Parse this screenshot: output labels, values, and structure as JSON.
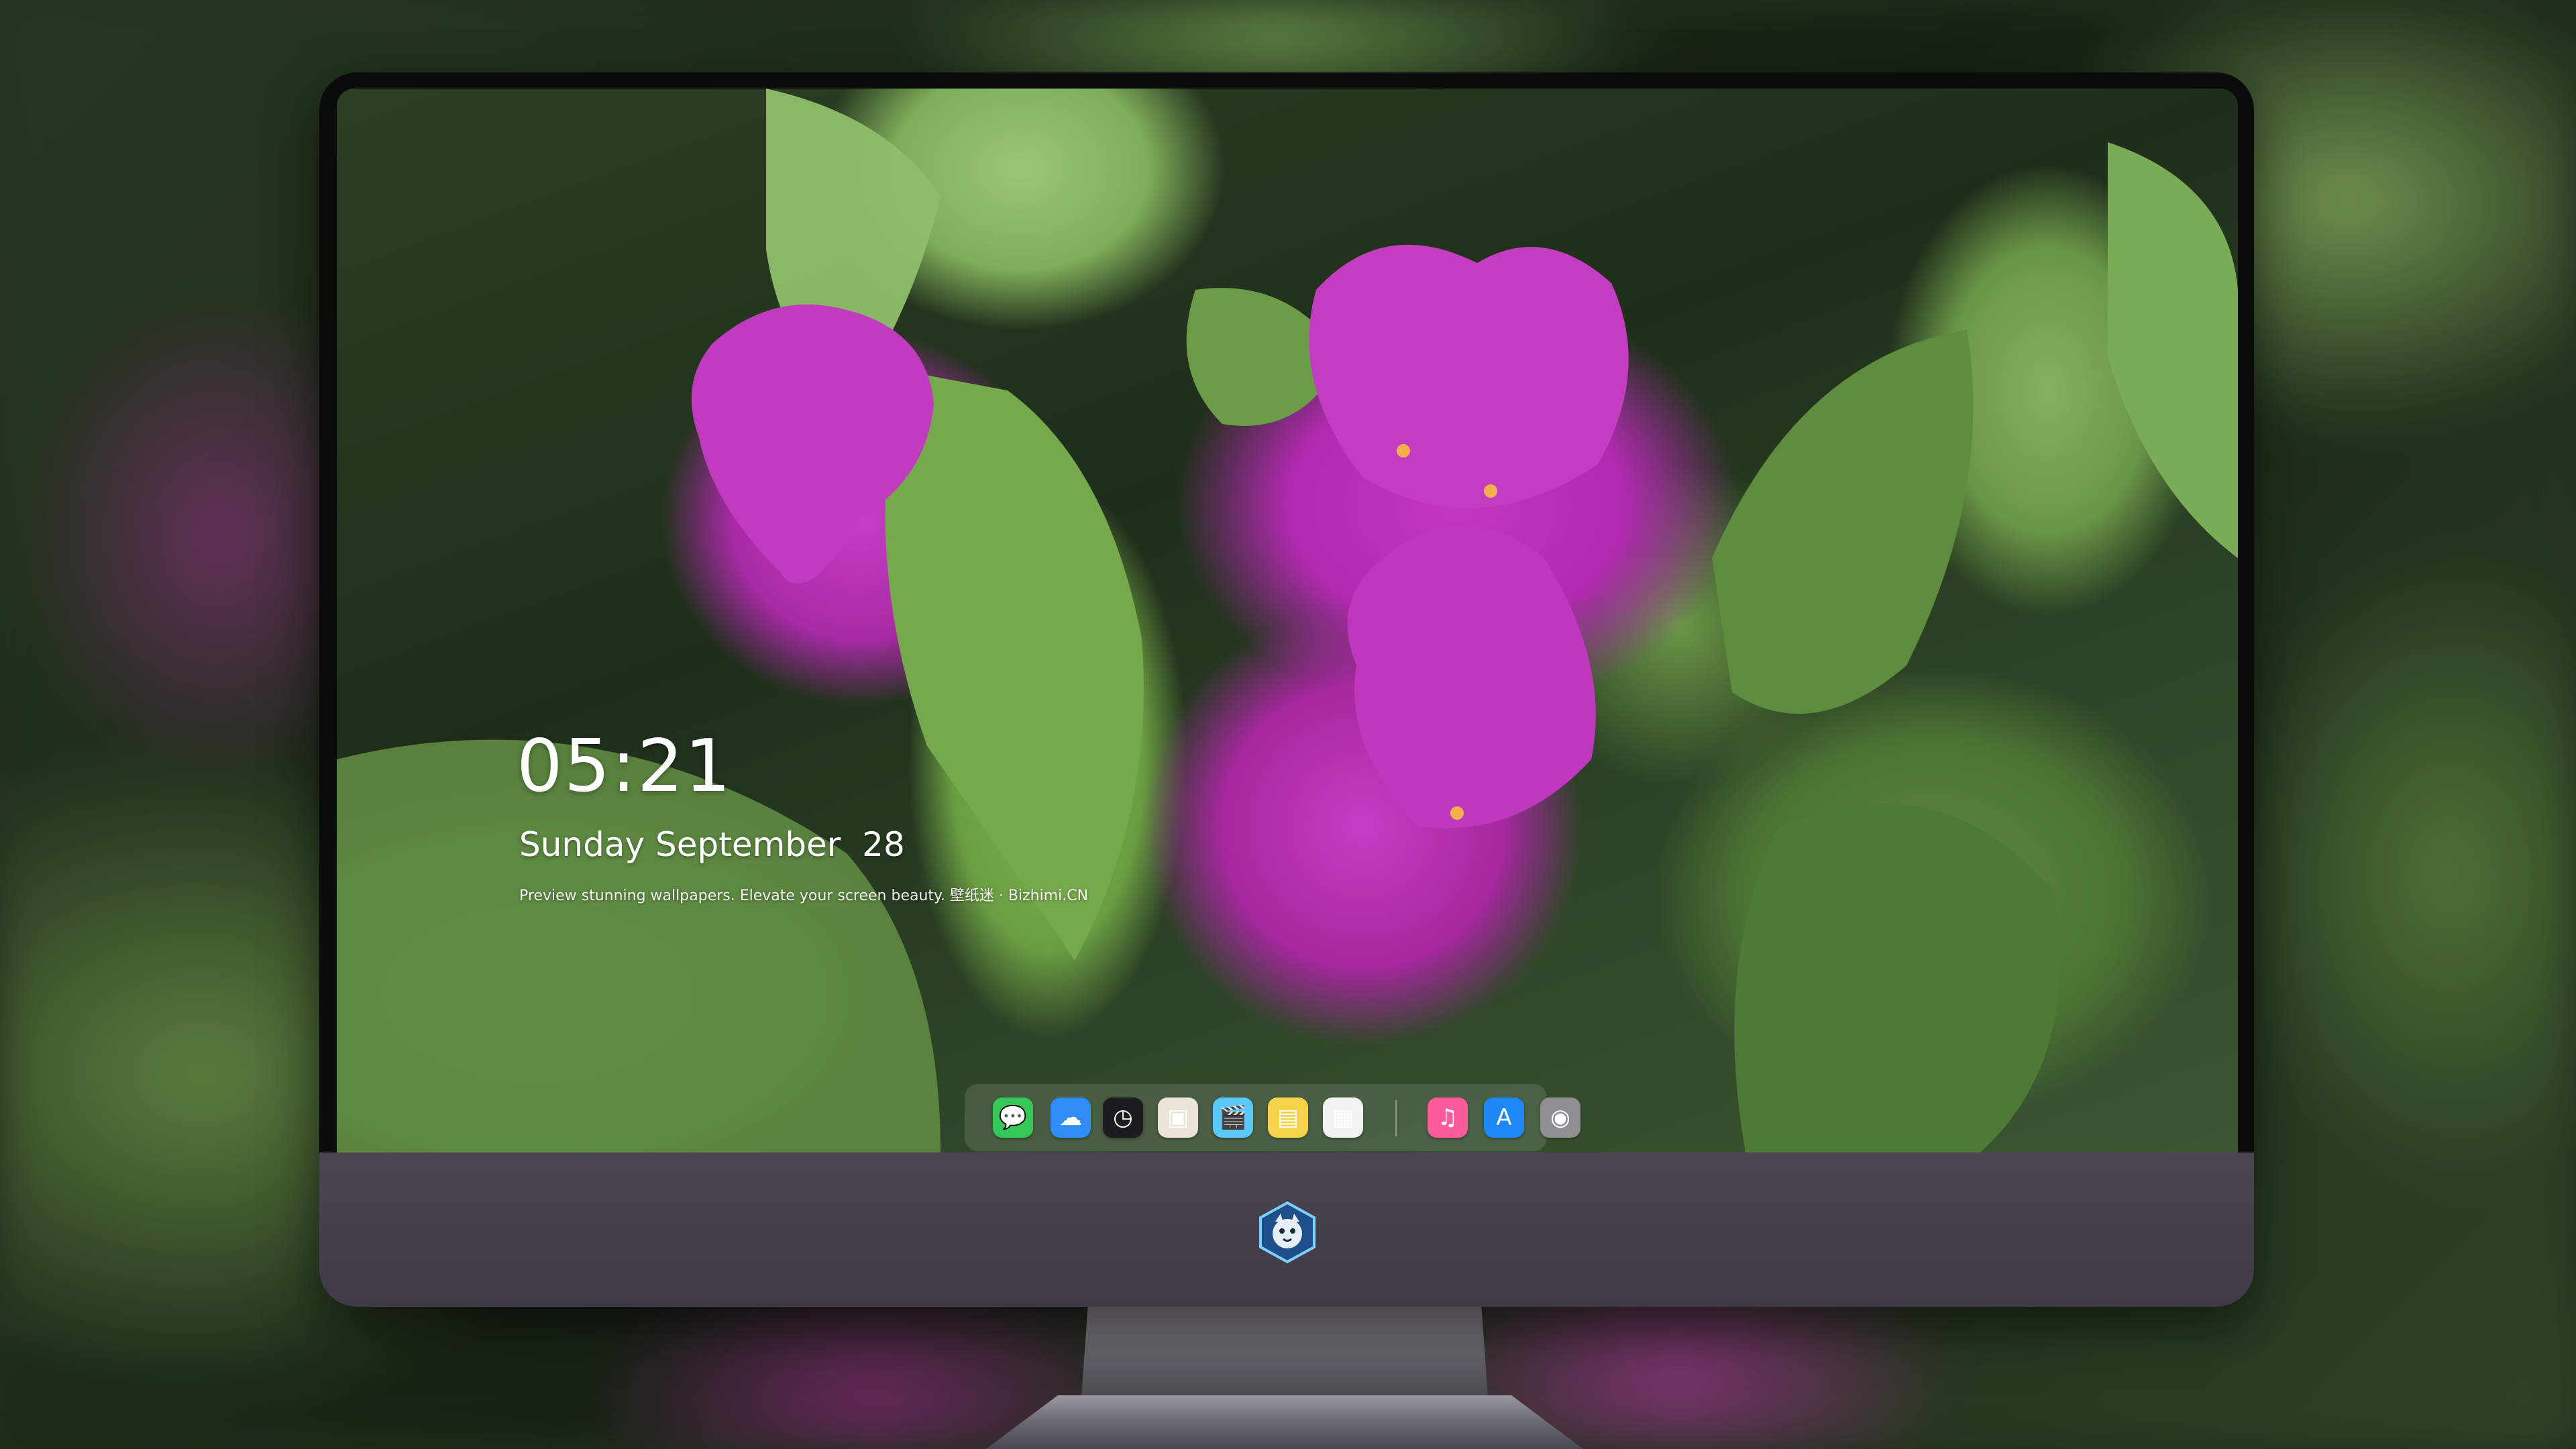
{
  "lock_screen": {
    "time": "05:21",
    "date": "Sunday September  28",
    "tagline": "Preview stunning wallpapers. Elevate your screen beauty. 壁纸迷 · Bizhimi.CN"
  },
  "dock": {
    "apps": [
      {
        "name": "messages-icon",
        "color": "#34c759",
        "glyph": "💬"
      },
      {
        "name": "weather-icon",
        "color": "#2f8df5",
        "glyph": "☁"
      },
      {
        "name": "clock-icon",
        "color": "#1c1c1e",
        "glyph": "◷"
      },
      {
        "name": "preview-icon",
        "color": "#e9e4d6",
        "glyph": "▣"
      },
      {
        "name": "clips-icon",
        "color": "#5ac8fa",
        "glyph": "🎬"
      },
      {
        "name": "notes-icon",
        "color": "#f5d44b",
        "glyph": "▤"
      },
      {
        "name": "photos-icon",
        "color": "#f2f2f2",
        "glyph": "▦"
      },
      {
        "name": "music-icon",
        "color": "#fc5c9c",
        "glyph": "♫"
      },
      {
        "name": "app-store-icon",
        "color": "#1e88f7",
        "glyph": "A"
      },
      {
        "name": "camera-icon",
        "color": "#8e8e93",
        "glyph": "◉"
      }
    ]
  },
  "colors": {
    "accent_flower": "#b02aae",
    "leaf": "#6a9c42",
    "bezel": "#0b0b0c",
    "chin": "#433e48"
  }
}
